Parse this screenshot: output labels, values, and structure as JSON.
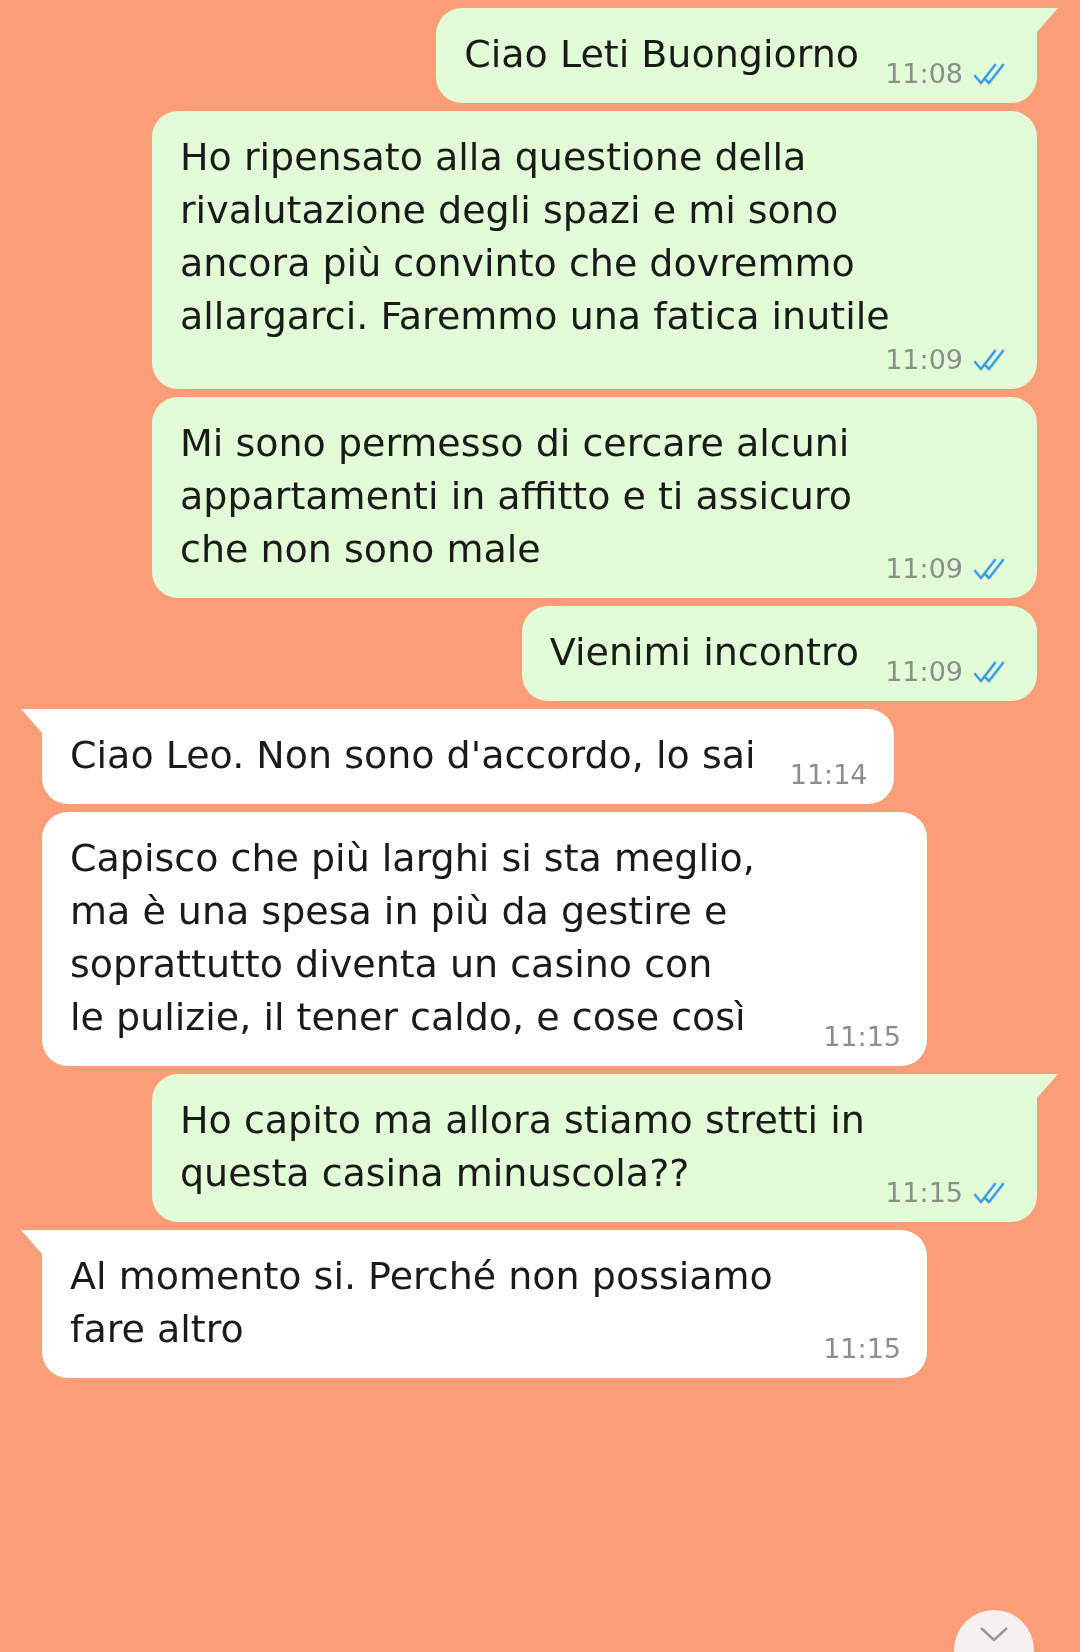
{
  "messages": [
    {
      "kind": "out",
      "tail": true,
      "text": "Ciao Leti Buongiorno",
      "time": "11:08",
      "read": true
    },
    {
      "kind": "out",
      "tail": false,
      "text": "Ho ripensato alla questione della\nrivalutazione degli spazi e mi sono\nancora più convinto che dovremmo\nallargarci. Faremmo una fatica inutile",
      "time": "11:09",
      "read": true
    },
    {
      "kind": "out",
      "tail": false,
      "text": "Mi sono permesso di cercare alcuni\nappartamenti in affitto e ti assicuro\nche non sono male",
      "time": "11:09",
      "read": true
    },
    {
      "kind": "out",
      "tail": false,
      "text": "Vienimi incontro",
      "time": "11:09",
      "read": true
    },
    {
      "kind": "in",
      "tail": true,
      "text": "Ciao Leo. Non sono d'accordo, lo sai",
      "time": "11:14"
    },
    {
      "kind": "in",
      "tail": false,
      "text": "Capisco che più larghi si sta meglio,\nma è una spesa in più da gestire e\nsoprattutto diventa un casino con\nle pulizie, il tener caldo, e cose così",
      "time": "11:15"
    },
    {
      "kind": "out",
      "tail": true,
      "text": "Ho capito ma allora stiamo stretti in\nquesta casina minuscola??",
      "time": "11:15",
      "read": true
    },
    {
      "kind": "in",
      "tail": true,
      "text": "Al momento si. Perché non possiamo\nfare altro",
      "time": "11:15"
    }
  ]
}
